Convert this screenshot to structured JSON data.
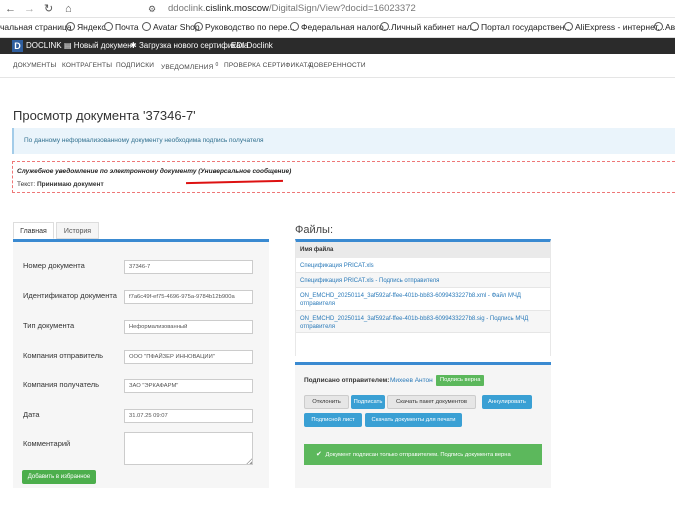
{
  "browser": {
    "url_prefix": "ddoclink.",
    "url_host": "cislink.moscow",
    "url_path": "/DigitalSign/View?docid=16023372",
    "bookmarks": [
      "чальная страница",
      "Яндекс",
      "Почта",
      "Avatar Shop",
      "Руководство по пере...",
      "Федеральная налого...",
      "Личный кабинет нал...",
      "Портал государствен...",
      "AliExpress - интернет...",
      "Ави"
    ]
  },
  "appbar": {
    "logo_letter": "D",
    "brand": "DOCLINK",
    "new_doc": "Новый документ",
    "upload_cert": "Загрузка нового сертификата",
    "edi": "EDI Doclink"
  },
  "menu": [
    "ДОКУМЕНТЫ",
    "КОНТРАГЕНТЫ",
    "ПОДПИСКИ",
    "УВЕДОМЛЕНИЯ",
    "ПРОВЕРКА СЕРТИФИКАТА",
    "ДОВЕРЕННОСТИ"
  ],
  "notifications_count": "0",
  "page_title": "Просмотр документа '37346-7'",
  "info_message": "По данному неформализованному документу необходима подпись получателя",
  "notice": {
    "line1": "Служебное уведомление по электронному документу (Универсальное сообщение)",
    "text_label": "Текст:",
    "text_value": "Принимаю документ"
  },
  "tabs": [
    "Главная",
    "История"
  ],
  "form": {
    "fields": [
      {
        "label": "Номер документа",
        "value": "37346-7"
      },
      {
        "label": "Идентификатор документа",
        "value": "f7a6c49f-ef75-4696-975a-9784b12b900a"
      },
      {
        "label": "Тип документа",
        "value": "Неформализованный"
      },
      {
        "label": "Компания отправитель",
        "value": "ООО \"ПФАЙЗЕР ИННОВАЦИИ\""
      },
      {
        "label": "Компания получатель",
        "value": "ЗАО \"ЭРКАФАРМ\""
      },
      {
        "label": "Дата",
        "value": "31.07.25 09:07"
      },
      {
        "label": "Комментарий",
        "value": ""
      }
    ],
    "add_favorite": "Добавить в избранное"
  },
  "files": {
    "title": "Файлы:",
    "header": "Имя файла",
    "rows": [
      "Спецификация PRICAT.xls",
      "Спецификация PRICAT.xls - Подпись отправителя",
      "ON_EMCHD_20250114_3af592af-ffee-401b-bb83-6099433227b8.xml - Файл МЧД отправителя",
      "ON_EMCHD_20250114_3af592af-ffee-401b-bb83-6099433227b8.sig - Подпись МЧД отправителя"
    ]
  },
  "signature": {
    "label": "Подписано отправителем:",
    "signer": "Михеев Антон",
    "valid_badge": "Подпись верна",
    "buttons": [
      "Отклонить",
      "Подписать",
      "Скачать пакет документов",
      "Аннулировать",
      "Подписной лист",
      "Скачать документы для печати"
    ],
    "alert": "Документ подписан только отправителем. Подпись документа верна"
  }
}
